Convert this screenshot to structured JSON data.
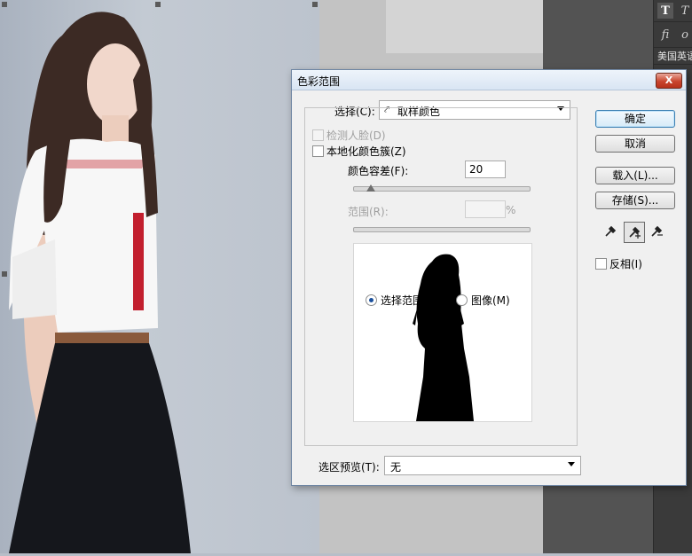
{
  "right_panel": {
    "tool_text": "T",
    "tool_text_vertical": "T",
    "tool_ligature": "fi",
    "tool_script": "o",
    "tool_script2": "o",
    "lang_text": "美国英语"
  },
  "dialog": {
    "title": "色彩范围",
    "close_label": "X",
    "select": {
      "label": "选择(C):",
      "value": "取样颜色"
    },
    "detect_faces": {
      "label": "检测人脸(D)",
      "checked": false,
      "enabled": false
    },
    "localized": {
      "label": "本地化颜色簇(Z)",
      "checked": false
    },
    "fuzziness": {
      "label": "颜色容差(F):",
      "value": "20",
      "slider_fraction": 0.1
    },
    "range": {
      "label": "范围(R):",
      "value": "",
      "unit": "%"
    },
    "view": {
      "selection_label": "选择范围(E)",
      "image_label": "图像(M)",
      "selected": "selection"
    },
    "preview": {
      "label": "选区预览(T):",
      "value": "无"
    },
    "buttons": {
      "ok": "确定",
      "cancel": "取消",
      "load": "载入(L)...",
      "save": "存储(S)..."
    },
    "invert": {
      "label": "反相(I)",
      "checked": false
    }
  },
  "colors": {
    "accent": "#3c7fb1",
    "close_red": "#c9452e",
    "panel_dark": "#3a3a3a"
  }
}
